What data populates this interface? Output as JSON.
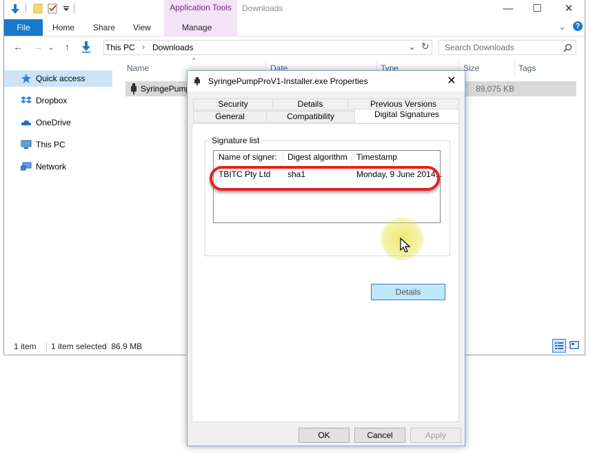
{
  "explorer": {
    "context_tab": "Application Tools",
    "window_title": "Downloads",
    "ribbon_tabs": {
      "file": "File",
      "home": "Home",
      "share": "Share",
      "view": "View",
      "manage": "Manage"
    },
    "address": {
      "crumb1": "This PC",
      "sep": "›",
      "crumb2": "Downloads"
    },
    "search_placeholder": "Search Downloads",
    "nav_items": [
      "Quick access",
      "Dropbox",
      "OneDrive",
      "This PC",
      "Network"
    ],
    "columns": {
      "name": "Name",
      "date": "Date",
      "type": "Type",
      "size": "Size",
      "tags": "Tags"
    },
    "file_row": {
      "name": "SyringePump",
      "size": "89,075 KB"
    },
    "status": {
      "items": "1 item",
      "selected": "1 item selected  86.9 MB"
    },
    "icons": {
      "min": "—",
      "max": "☐",
      "close": "✕",
      "back": "←",
      "fwd": "→",
      "up": "↑",
      "dropdown": "⌄",
      "refresh": "↻",
      "search": "⌕",
      "help": "?"
    }
  },
  "dialog": {
    "title": "SyringePumpProV1-Installer.exe Properties",
    "close": "✕",
    "tabs_row1": [
      "Security",
      "Details",
      "Previous Versions"
    ],
    "tabs_row2": [
      "General",
      "Compatibility",
      "Digital Signatures"
    ],
    "active_tab": "Digital Signatures",
    "group_label": "Signature list",
    "list_headers": [
      "Name of signer:",
      "Digest algorithm",
      "Timestamp"
    ],
    "list_rows": [
      {
        "signer": "TBITC Pty Ltd",
        "algorithm": "sha1",
        "timestamp": "Monday, 9 June 2014..."
      }
    ],
    "details_button": "Details",
    "buttons": {
      "ok": "OK",
      "cancel": "Cancel",
      "apply": "Apply"
    }
  },
  "colors": {
    "file_tab": "#1979ca",
    "context_tab_bg": "#f4e3f7",
    "highlight_oval": "#e81f1f",
    "details_button": "#bee6fd",
    "nav_selected": "#cce4f7"
  }
}
